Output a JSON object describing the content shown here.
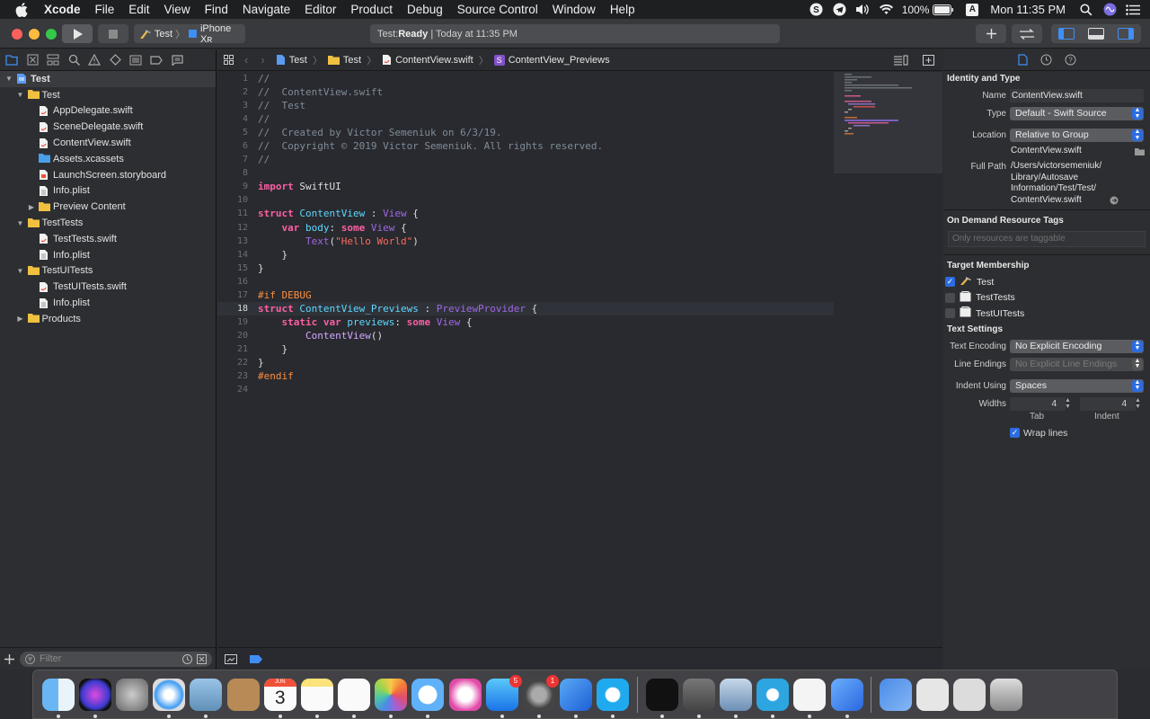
{
  "menubar": {
    "app": "Xcode",
    "items": [
      "File",
      "Edit",
      "View",
      "Find",
      "Navigate",
      "Editor",
      "Product",
      "Debug",
      "Source Control",
      "Window",
      "Help"
    ],
    "battery": "100%",
    "user_initial": "A",
    "clock": "Mon 11:35 PM"
  },
  "toolbar": {
    "scheme": "Test",
    "device": "iPhone Xʀ",
    "status_project": "Test: ",
    "status_state": "Ready",
    "status_time": " | Today at 11:35 PM"
  },
  "navigator": {
    "tree": [
      {
        "label": "Test",
        "level": 0,
        "type": "project",
        "disclosure": "open"
      },
      {
        "label": "Test",
        "level": 1,
        "type": "folder",
        "disclosure": "open"
      },
      {
        "label": "AppDelegate.swift",
        "level": 2,
        "type": "swift"
      },
      {
        "label": "SceneDelegate.swift",
        "level": 2,
        "type": "swift"
      },
      {
        "label": "ContentView.swift",
        "level": 2,
        "type": "swift"
      },
      {
        "label": "Assets.xcassets",
        "level": 2,
        "type": "assets"
      },
      {
        "label": "LaunchScreen.storyboard",
        "level": 2,
        "type": "storyboard"
      },
      {
        "label": "Info.plist",
        "level": 2,
        "type": "plist"
      },
      {
        "label": "Preview Content",
        "level": 2,
        "type": "folder",
        "disclosure": "closed"
      },
      {
        "label": "TestTests",
        "level": 1,
        "type": "folder",
        "disclosure": "open"
      },
      {
        "label": "TestTests.swift",
        "level": 2,
        "type": "swift"
      },
      {
        "label": "Info.plist",
        "level": 2,
        "type": "plist"
      },
      {
        "label": "TestUITests",
        "level": 1,
        "type": "folder",
        "disclosure": "open"
      },
      {
        "label": "TestUITests.swift",
        "level": 2,
        "type": "swift"
      },
      {
        "label": "Info.plist",
        "level": 2,
        "type": "plist"
      },
      {
        "label": "Products",
        "level": 1,
        "type": "folder",
        "disclosure": "closed"
      }
    ],
    "filter_placeholder": "Filter"
  },
  "jumpbar": {
    "crumbs": [
      "Test",
      "Test",
      "ContentView.swift",
      "ContentView_Previews"
    ]
  },
  "editor": {
    "current_line": 18,
    "lines": [
      [
        [
          "cmt",
          "//"
        ]
      ],
      [
        [
          "cmt",
          "//  ContentView.swift"
        ]
      ],
      [
        [
          "cmt",
          "//  Test"
        ]
      ],
      [
        [
          "cmt",
          "//"
        ]
      ],
      [
        [
          "cmt",
          "//  Created by Victor Semeniuk on 6/3/19."
        ]
      ],
      [
        [
          "cmt",
          "//  Copyright © 2019 Victor Semeniuk. All rights reserved."
        ]
      ],
      [
        [
          "cmt",
          "//"
        ]
      ],
      [],
      [
        [
          "kw",
          "import"
        ],
        [
          "pl",
          " SwiftUI"
        ]
      ],
      [],
      [
        [
          "kw",
          "struct"
        ],
        [
          "pl",
          " "
        ],
        [
          "dcl",
          "ContentView"
        ],
        [
          "pl",
          " : "
        ],
        [
          "uty",
          "View"
        ],
        [
          "pl",
          " {"
        ]
      ],
      [
        [
          "pl",
          "    "
        ],
        [
          "kw",
          "var"
        ],
        [
          "pl",
          " "
        ],
        [
          "dcl",
          "body"
        ],
        [
          "pl",
          ": "
        ],
        [
          "kw",
          "some"
        ],
        [
          "pl",
          " "
        ],
        [
          "uty",
          "View"
        ],
        [
          "pl",
          " {"
        ]
      ],
      [
        [
          "pl",
          "        "
        ],
        [
          "uty",
          "Text"
        ],
        [
          "pl",
          "("
        ],
        [
          "str",
          "\"Hello World\""
        ],
        [
          "pl",
          ")"
        ]
      ],
      [
        [
          "pl",
          "    }"
        ]
      ],
      [
        [
          "pl",
          "}"
        ]
      ],
      [],
      [
        [
          "pp",
          "#if DEBUG"
        ]
      ],
      [
        [
          "kw",
          "struct"
        ],
        [
          "pl",
          " "
        ],
        [
          "dcl",
          "ContentView_Previews"
        ],
        [
          "pl",
          " : "
        ],
        [
          "uty",
          "PreviewProvider"
        ],
        [
          "pl",
          " {"
        ]
      ],
      [
        [
          "pl",
          "    "
        ],
        [
          "kw",
          "static"
        ],
        [
          "pl",
          " "
        ],
        [
          "kw",
          "var"
        ],
        [
          "pl",
          " "
        ],
        [
          "dcl",
          "previews"
        ],
        [
          "pl",
          ": "
        ],
        [
          "kw",
          "some"
        ],
        [
          "pl",
          " "
        ],
        [
          "uty",
          "View"
        ],
        [
          "pl",
          " {"
        ]
      ],
      [
        [
          "pl",
          "        "
        ],
        [
          "ty",
          "ContentView"
        ],
        [
          "pl",
          "()"
        ]
      ],
      [
        [
          "pl",
          "    }"
        ]
      ],
      [
        [
          "pl",
          "}"
        ]
      ],
      [
        [
          "pp",
          "#endif"
        ]
      ],
      []
    ]
  },
  "inspector": {
    "identity_title": "Identity and Type",
    "name_label": "Name",
    "name_value": "ContentView.swift",
    "type_label": "Type",
    "type_value": "Default - Swift Source",
    "location_label": "Location",
    "location_value": "Relative to Group",
    "location_file": "ContentView.swift",
    "fullpath_label": "Full Path",
    "fullpath_lines": [
      "/Users/victorsemeniuk/",
      "Library/Autosave",
      "Information/Test/Test/",
      "ContentView.swift"
    ],
    "odr_title": "On Demand Resource Tags",
    "odr_placeholder": "Only resources are taggable",
    "target_title": "Target Membership",
    "targets": [
      {
        "name": "Test",
        "checked": true
      },
      {
        "name": "TestTests",
        "checked": false
      },
      {
        "name": "TestUITests",
        "checked": false
      }
    ],
    "text_title": "Text Settings",
    "encoding_label": "Text Encoding",
    "encoding_value": "No Explicit Encoding",
    "endings_label": "Line Endings",
    "endings_value": "No Explicit Line Endings",
    "indent_label": "Indent Using",
    "indent_value": "Spaces",
    "widths_label": "Widths",
    "tab_value": "4",
    "indent_width_value": "4",
    "tab_caption": "Tab",
    "indent_caption": "Indent",
    "wrap_label": "Wrap lines",
    "wrap_checked": true
  },
  "dock": {
    "apps": [
      "Finder",
      "Siri",
      "Launchpad",
      "Safari",
      "Preview",
      "Contacts",
      "Calendar",
      "Notes",
      "Reminders",
      "Photos",
      "Messages",
      "iTunes",
      "App Store",
      "System Preferences",
      "Xcode",
      "Skype",
      "Activity Monitor",
      "Keychain Access",
      "Image Capture",
      "Telegram",
      "TextEdit",
      "Xcode Beta",
      "Downloads",
      "Documents",
      "Desktop",
      "Trash"
    ],
    "calendar_month": "JUN",
    "calendar_day": "3",
    "appstore_badge": "5",
    "sysprefs_badge": "1"
  }
}
